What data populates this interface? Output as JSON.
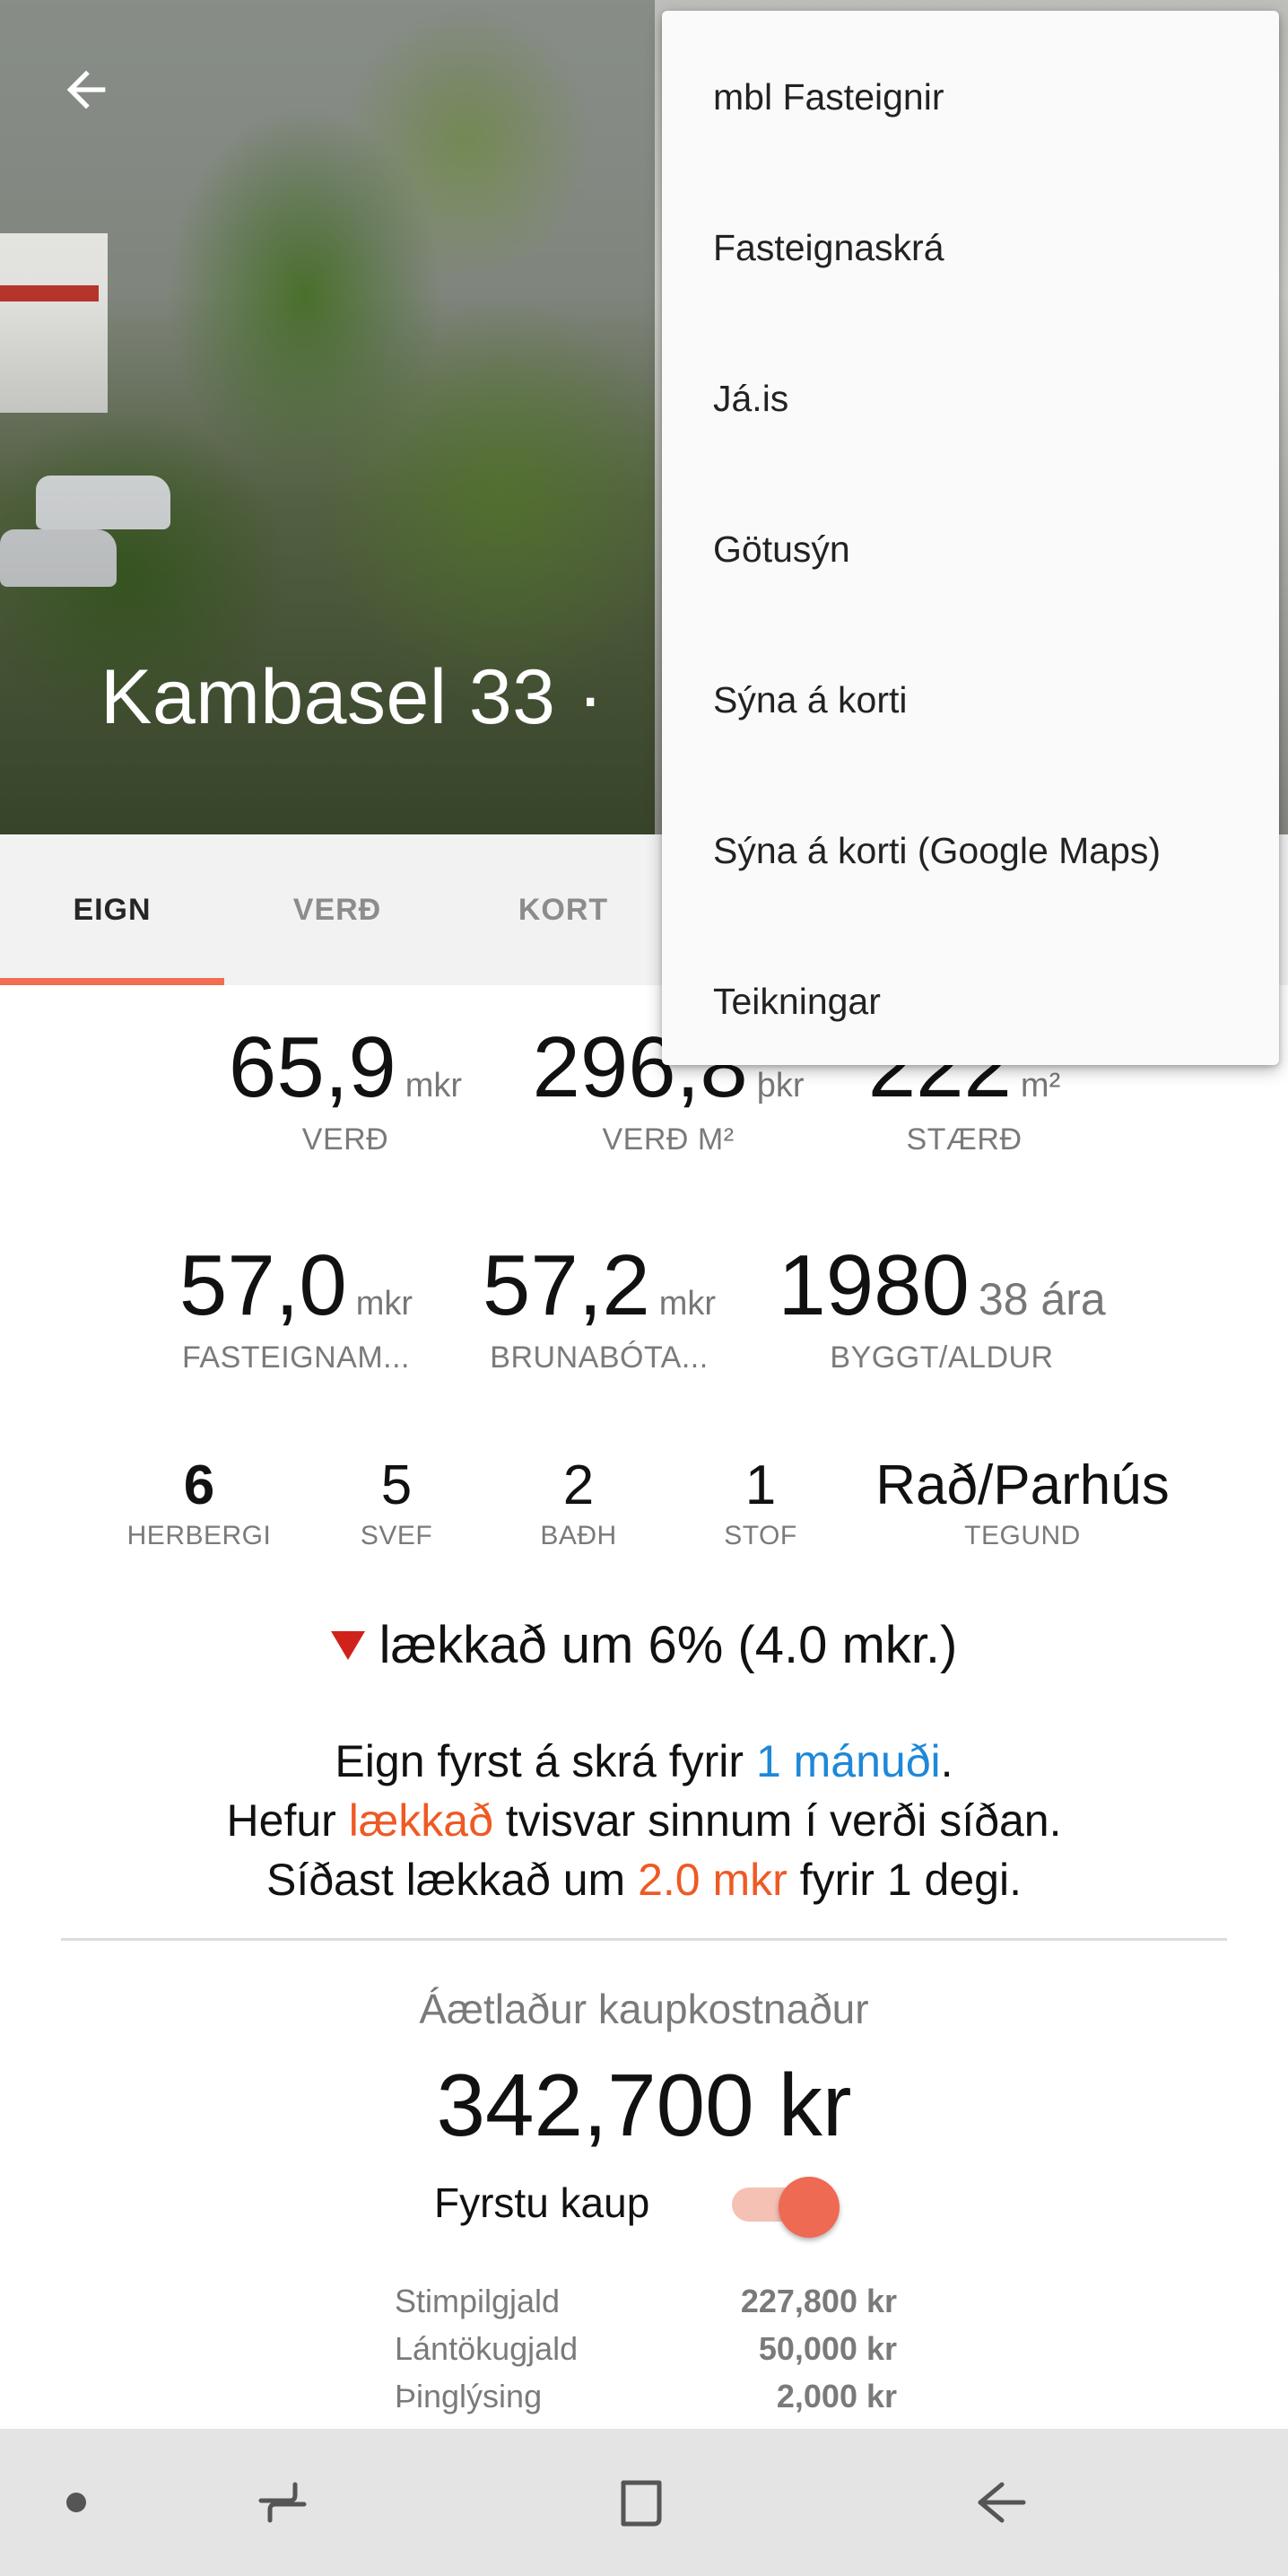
{
  "header": {
    "title": "Kambasel 33 ·",
    "back_icon": "arrow-back-icon"
  },
  "tabs": [
    {
      "label": "EIGN",
      "active": true
    },
    {
      "label": "VERÐ",
      "active": false
    },
    {
      "label": "KORT",
      "active": false
    }
  ],
  "stats_row1": [
    {
      "value": "65,9",
      "unit": "mkr",
      "label": "VERÐ"
    },
    {
      "value": "296,8",
      "unit": "þkr",
      "label": "VERÐ M²"
    },
    {
      "value": "222",
      "unit": "m²",
      "label": "STÆRÐ"
    }
  ],
  "stats_row2": [
    {
      "value": "57,0",
      "unit": "mkr",
      "label": "FASTEIGNAM..."
    },
    {
      "value": "57,2",
      "unit": "mkr",
      "label": "BRUNABÓTA..."
    },
    {
      "value": "1980",
      "unit": "38 ára",
      "label": "BYGGT/ALDUR"
    }
  ],
  "rooms": [
    {
      "value": "6",
      "label": "HERBERGI"
    },
    {
      "value": "5",
      "label": "SVEF"
    },
    {
      "value": "2",
      "label": "BAÐH"
    },
    {
      "value": "1",
      "label": "STOF"
    },
    {
      "value": "Rað/Parhús",
      "label": "TEGUND"
    }
  ],
  "price_change": "lækkað um 6% (4.0 mkr.)",
  "history": {
    "line1_pre": "Eign fyrst á skrá fyrir ",
    "line1_highlight": "1 mánuði",
    "line1_post": ".",
    "line2_pre": "Hefur ",
    "line2_highlight": "lækkað",
    "line2_post": " tvisvar sinnum í verði síðan.",
    "line3_pre": "Síðast lækkað um ",
    "line3_highlight": "2.0 mkr",
    "line3_post": " fyrir 1 degi."
  },
  "cost": {
    "title": "Áætlaður kaupkostnaður",
    "total": "342,700 kr",
    "first_purchase_label": "Fyrstu kaup",
    "first_purchase_on": true,
    "fees": [
      {
        "label": "Stimpilgjald",
        "amount": "227,800 kr"
      },
      {
        "label": "Lántökugjald",
        "amount": "50,000 kr"
      },
      {
        "label": "Þinglýsing",
        "amount": "2,000 kr"
      }
    ]
  },
  "menu": {
    "items": [
      "mbl Fasteignir",
      "Fasteignaskrá",
      "Já.is",
      "Götusýn",
      "Sýna á korti",
      "Sýna á korti (Google Maps)",
      "Teikningar"
    ]
  },
  "navbar": {
    "icons": [
      "dot-icon",
      "recent-apps-icon",
      "home-square-icon",
      "back-arrow-icon"
    ]
  },
  "colors": {
    "accent": "#f06e51",
    "link_blue": "#1e88d9",
    "drop_orange": "#ee5a24",
    "drop_red": "#d0221b"
  }
}
